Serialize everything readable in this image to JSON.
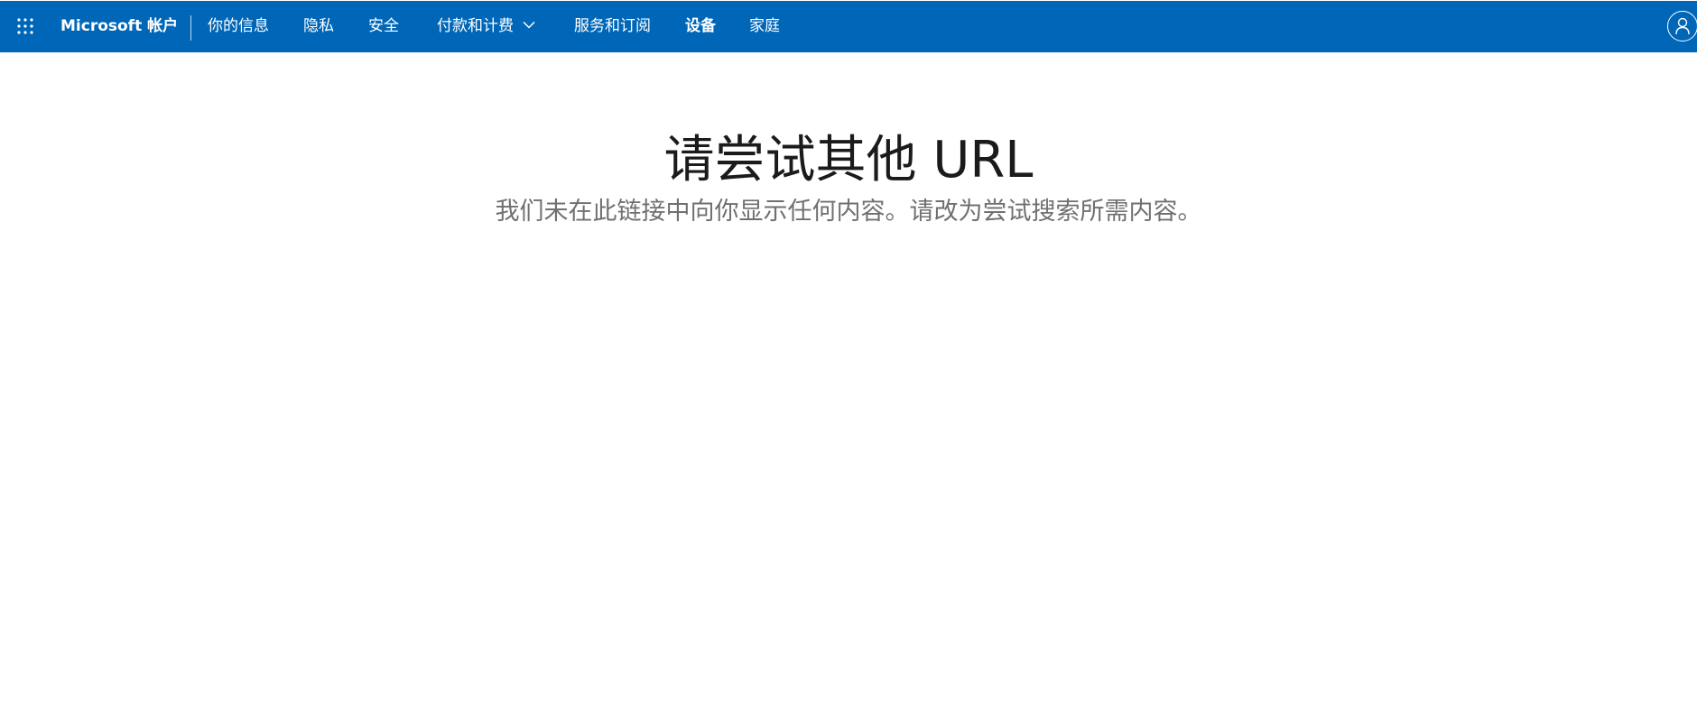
{
  "header": {
    "brand": "Microsoft 帐户",
    "nav": [
      {
        "label": "你的信息"
      },
      {
        "label": "隐私"
      },
      {
        "label": "安全"
      },
      {
        "label": "付款和计费"
      },
      {
        "label": "服务和订阅"
      },
      {
        "label": "设备"
      },
      {
        "label": "家庭"
      }
    ],
    "active_nav": "设备",
    "icons": {
      "app_launcher": "waffle-icon",
      "dropdown": "chevron-down-icon",
      "account": "person-icon"
    }
  },
  "main": {
    "title": "请尝试其他 URL",
    "subtitle": "我们未在此链接中向你显示任何内容。请改为尝试搜索所需内容。"
  },
  "colors": {
    "header_bg": "#0067b8",
    "header_text": "#ffffff",
    "title_text": "#1b1b1b",
    "subtitle_text": "#707070"
  }
}
